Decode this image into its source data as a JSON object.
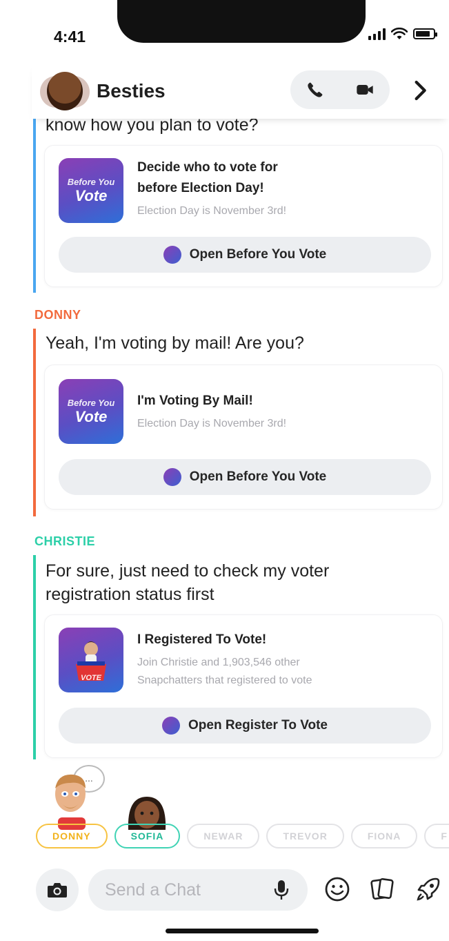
{
  "status_bar": {
    "time": "4:41",
    "battery_level": 0.85
  },
  "header": {
    "title": "Besties",
    "icons": [
      "phone-icon",
      "video-icon",
      "chevron-right-icon"
    ]
  },
  "messages": [
    {
      "sender": "",
      "text": "know how you plan to vote?",
      "color": "#4aa6f0",
      "card": {
        "thumb_small": "Before You",
        "thumb_big": "Vote",
        "title_line1": "Decide who to vote for",
        "title_line2": "before Election Day!",
        "subtitle": "Election Day is November 3rd!",
        "button": "Open Before You Vote"
      }
    },
    {
      "sender": "DONNY",
      "text": "Yeah, I'm voting by mail! Are you?",
      "color": "#f26a3d",
      "card": {
        "thumb_small": "Before You",
        "thumb_big": "Vote",
        "title_line1": "I'm Voting By Mail!",
        "subtitle": "Election Day is November 3rd!",
        "button": "Open Before You Vote"
      }
    },
    {
      "sender": "CHRISTIE",
      "text_line1": "For sure, just need to check my voter",
      "text_line2": "registration status first",
      "color": "#2ccfa8",
      "card": {
        "thumb_big": "VOTE",
        "title_line1": "I Registered To Vote!",
        "subtitle_line1": "Join Christie and 1,903,546 other",
        "subtitle_line2": "Snapchatters that registered to vote",
        "button": "Open Register To Vote"
      }
    }
  ],
  "typing_indicator": "...",
  "presence": [
    "DONNY",
    "SOFIA",
    "NEWAR",
    "TREVOR",
    "FIONA",
    "F"
  ],
  "composer": {
    "placeholder": "Send a Chat",
    "icons": [
      "camera-icon",
      "microphone-icon",
      "smiley-icon",
      "cards-icon",
      "rocket-icon"
    ]
  }
}
